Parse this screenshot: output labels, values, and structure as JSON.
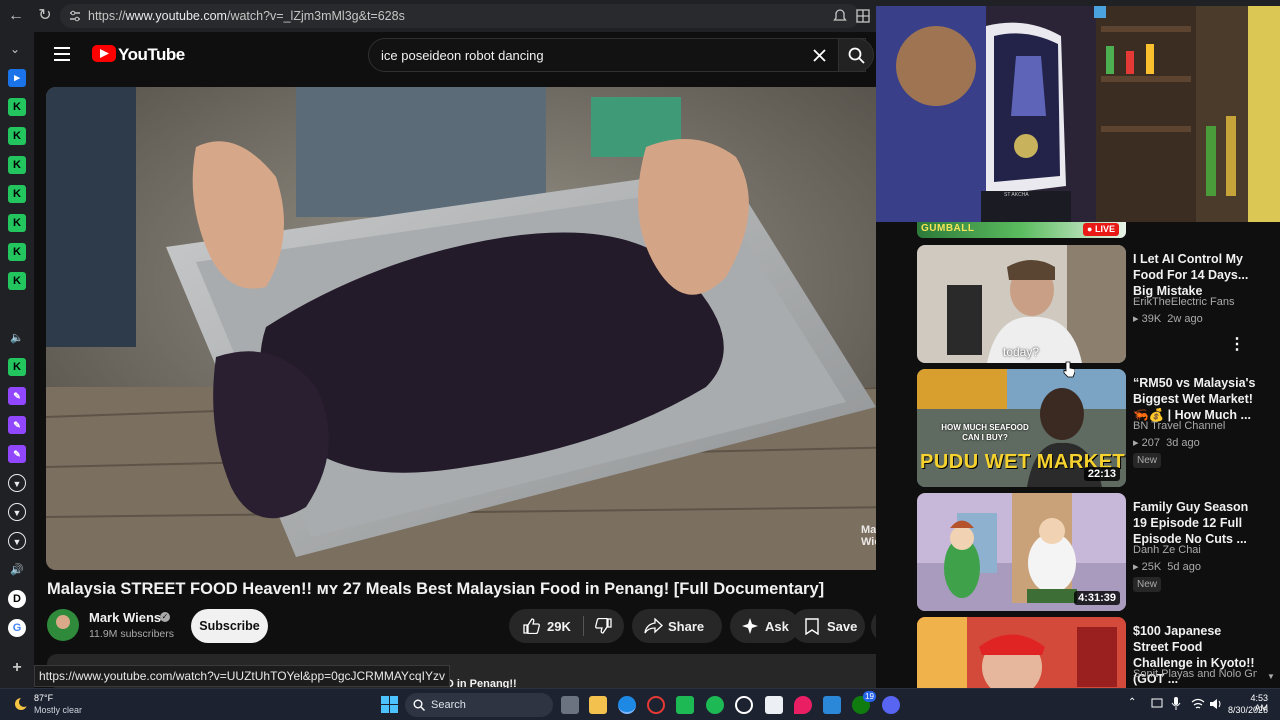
{
  "browser": {
    "url_prefix": "https://",
    "url_host": "www.youtube.com",
    "url_path": "/watch?v=_lZjm3mMl3g&t=628s"
  },
  "youtube": {
    "logo_text": "YouTube",
    "search_value": "ice poseideon robot dancing",
    "video_title": "Malaysia STREET FOOD Heaven!! ᴍʏ 27 Meals Best Malaysian Food in Penang! [Full Documentary]",
    "watermark": "Mark\nWiens",
    "channel_name": "Mark Wiens",
    "subscribers": "11.9M subscribers",
    "subscribe_label": "Subscribe",
    "likes": "29K",
    "share_label": "Share",
    "ask_label": "Ask",
    "save_label": "Save",
    "status_url": "https://www.youtube.com/watch?v=UUZtUhTOYel&pp=0gcJCRMMAYcqIYzv",
    "description_peek": "FOOD in Penang!!"
  },
  "stream": {
    "live_badge": "LIVE",
    "banner_text": "GUMBALL",
    "chair_text": "ST AKCHA"
  },
  "recommendations": [
    {
      "title": "I Let AI Control My Food For 14 Days... Big Mistake",
      "channel": "ErikTheElectric Fans",
      "views": "39K",
      "age": "2w ago",
      "caption": "today?",
      "new": ""
    },
    {
      "title": "“RM50 vs Malaysia's Biggest Wet Market! 🦐💰 | How Much ...",
      "channel": "BN Travel Channel",
      "views": "207",
      "age": "3d ago",
      "duration": "22:13",
      "thumb_text": "PUDU WET MARKET",
      "thumb_sub": "HOW MUCH SEAFOOD CAN I BUY?",
      "new": "New"
    },
    {
      "title": "Family Guy Season 19 Episode 12 Full Episode No Cuts ...",
      "channel": "Danh Ze Chai",
      "views": "25K",
      "age": "5d ago",
      "duration": "4:31:39",
      "new": "New"
    },
    {
      "title": "$100 Japanese Street Food Challenge in Kyoto!! (GOT ...",
      "channel": "Sonit Playas and Nolo Gm...",
      "views": "",
      "age": "",
      "new": ""
    }
  ],
  "taskbar": {
    "temperature": "87°F",
    "weather": "Mostly clear",
    "search_label": "Search",
    "time": "4:53 AM",
    "date": "8/30/2026",
    "badge_count": "19"
  },
  "colors": {
    "yt_red": "#ff0000",
    "accent_green": "#22c55e",
    "twitch_purple": "#9147ff",
    "live_red": "#e91916"
  }
}
